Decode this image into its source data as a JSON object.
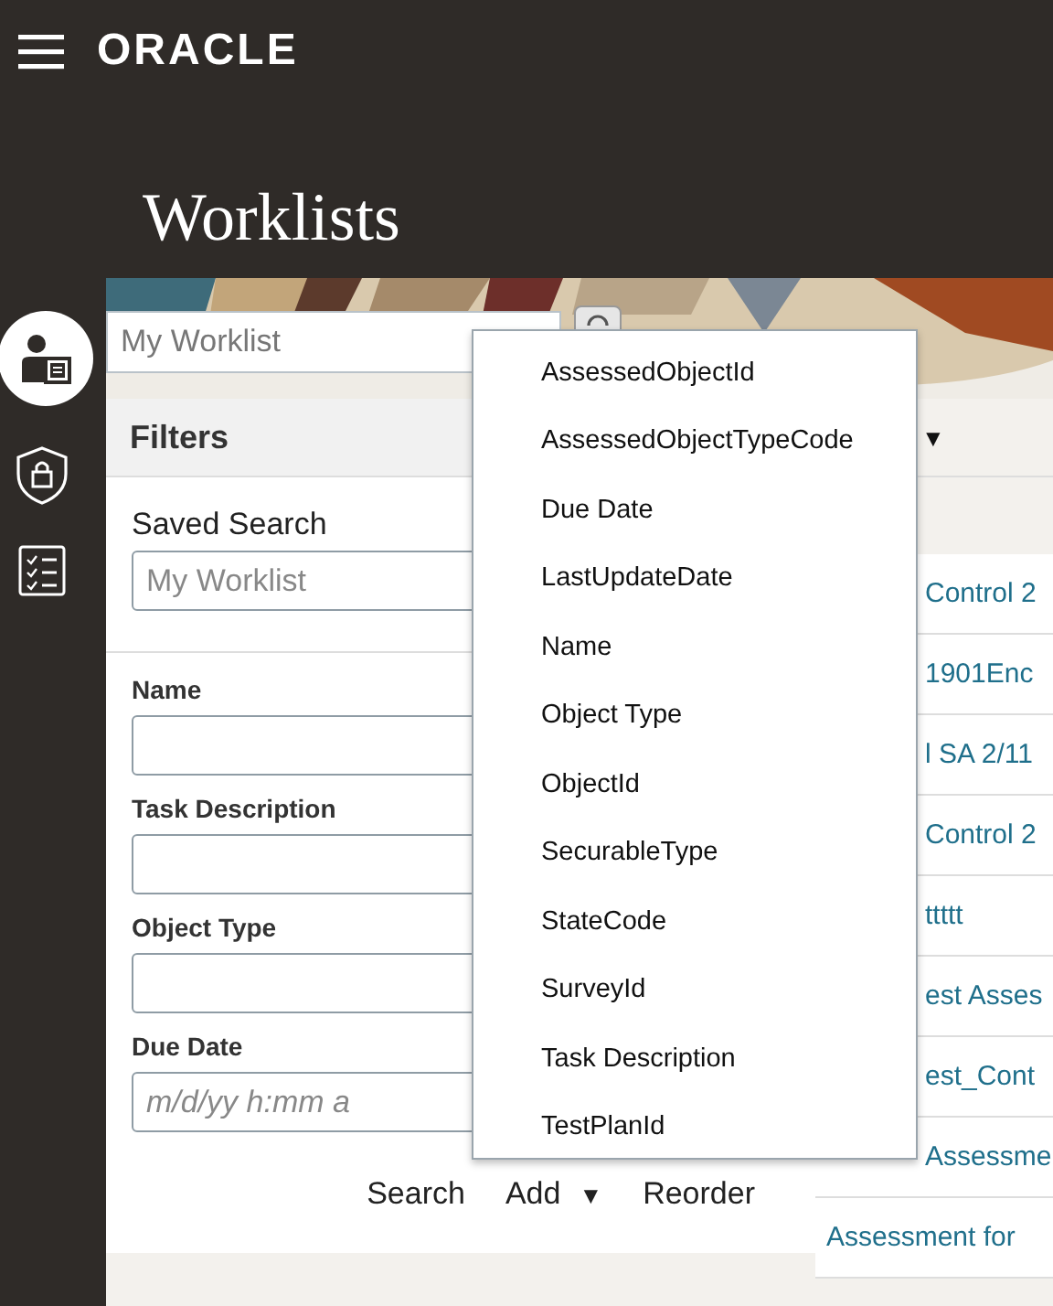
{
  "header": {
    "logo": "ORACLE",
    "title": "Worklists"
  },
  "worklist_select": {
    "value": "My Worklist"
  },
  "filters": {
    "title": "Filters",
    "saved_search": {
      "label": "Saved Search",
      "placeholder": "My Worklist"
    },
    "fields": [
      {
        "label": "Name"
      },
      {
        "label": "Task Description"
      },
      {
        "label": "Object Type"
      },
      {
        "label": "Due Date",
        "placeholder": "m/d/yy h:mm a"
      }
    ],
    "actions": [
      {
        "label": "Search"
      },
      {
        "label": "Add",
        "caret": "▼"
      },
      {
        "label": "Reorder"
      }
    ]
  },
  "results": {
    "header_arrow": "▼",
    "rows": [
      "Control 2",
      "1901Enc",
      "l SA 2/11",
      "Control 2",
      "ttttt",
      "est Asses",
      "est_Cont",
      "Assessme",
      "Assessment for"
    ]
  },
  "menu": {
    "items": [
      "AssessedObjectId",
      "AssessedObjectTypeCode",
      "Due Date",
      "LastUpdateDate",
      "Name",
      "Object Type",
      "ObjectId",
      "SecurableType",
      "StateCode",
      "SurveyId",
      "Task Description",
      "TestPlanId"
    ]
  }
}
